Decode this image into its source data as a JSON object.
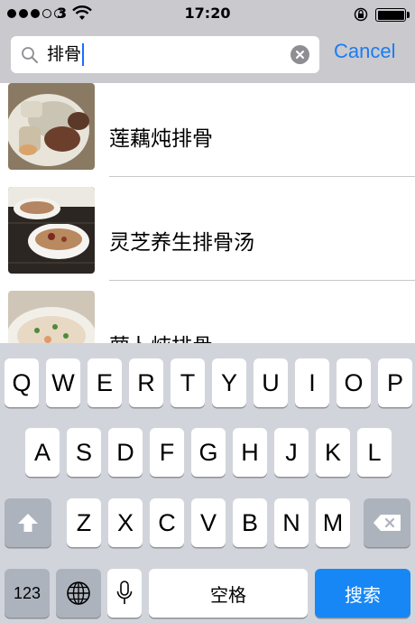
{
  "status_bar": {
    "carrier": "3",
    "time": "17:20",
    "signal_strength": 3,
    "battery_level": 1.0
  },
  "search": {
    "query": "排骨",
    "cancel_label": "Cancel"
  },
  "results": [
    {
      "label": "莲藕炖排骨",
      "thumbnail": "braised-pork-ribs-photo"
    },
    {
      "label": "灵芝养生排骨汤",
      "thumbnail": "rib-soup-bowls-photo"
    },
    {
      "label": "萝卜炖排骨",
      "thumbnail": "radish-rib-soup-photo"
    }
  ],
  "keyboard": {
    "row1": [
      "Q",
      "W",
      "E",
      "R",
      "T",
      "Y",
      "U",
      "I",
      "O",
      "P"
    ],
    "row2": [
      "A",
      "S",
      "D",
      "F",
      "G",
      "H",
      "J",
      "K",
      "L"
    ],
    "row3": [
      "Z",
      "X",
      "C",
      "V",
      "B",
      "N",
      "M"
    ],
    "numbers_label": "123",
    "space_label": "空格",
    "search_label": "搜索"
  },
  "colors": {
    "accent": "#1a7cf4",
    "search_key": "#1787f5",
    "header_bg": "#c9c9ce",
    "keyboard_bg": "#d1d5db"
  }
}
